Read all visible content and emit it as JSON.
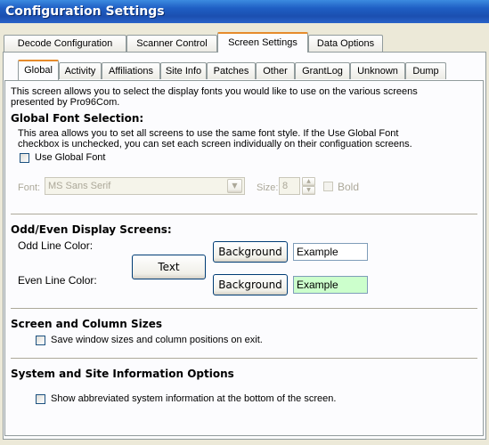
{
  "window": {
    "title": "Configuration Settings"
  },
  "outer_tabs": [
    {
      "label": "Decode Configuration"
    },
    {
      "label": "Scanner Control"
    },
    {
      "label": "Screen Settings"
    },
    {
      "label": "Data Options"
    }
  ],
  "inner_tabs": [
    {
      "label": "Global"
    },
    {
      "label": "Activity"
    },
    {
      "label": "Affiliations"
    },
    {
      "label": "Site Info"
    },
    {
      "label": "Patches"
    },
    {
      "label": "Other"
    },
    {
      "label": "GrantLog"
    },
    {
      "label": "Unknown"
    },
    {
      "label": "Dump"
    }
  ],
  "intro": {
    "line1": "This screen allows you to select the display fonts you would like to use on the various screens",
    "line2": "presented by Pro96Com."
  },
  "global_font": {
    "heading": "Global Font Selection:",
    "desc1": "This area allows you to set all screens to use the same font style.  If the Use Global Font",
    "desc2": "checkbox is unchecked, you can set each screen individually on their configuation screens.",
    "use_global_label": "Use Global Font",
    "font_label": "Font:",
    "font_value": "MS Sans Serif",
    "size_label": "Size:",
    "size_value": "8",
    "bold_label": "Bold"
  },
  "odd_even": {
    "heading": "Odd/Even Display Screens:",
    "odd_label": "Odd Line Color:",
    "even_label": "Even Line Color:",
    "text_button": "Text",
    "odd_bg_button": "Background",
    "even_bg_button": "Background",
    "odd_example": "Example",
    "even_example": "Example",
    "even_example_color": "#ccffcc"
  },
  "sizes": {
    "heading": "Screen and Column Sizes",
    "save_label": "Save window sizes and column positions on exit."
  },
  "system_info": {
    "heading": "System and Site Information Options",
    "show_label": "Show abbreviated system information at the bottom of the screen."
  }
}
